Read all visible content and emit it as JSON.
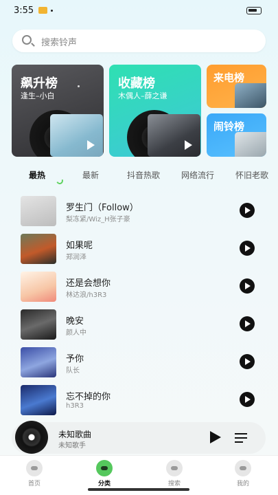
{
  "status_bar": {
    "time": "3:55"
  },
  "search": {
    "placeholder": "搜索铃声"
  },
  "categories": [
    {
      "title": "飙升榜",
      "subtitle": "逢生–小白"
    },
    {
      "title": "收藏榜",
      "subtitle": "木偶人–薛之谦"
    },
    {
      "title": "来电榜"
    },
    {
      "title": "闹铃榜"
    }
  ],
  "tabs": [
    "最热",
    "最新",
    "抖音热歌",
    "网络流行",
    "怀旧老歌"
  ],
  "active_tab": "最热",
  "songs": [
    {
      "title": "罗生门（Follow）",
      "artist": "梨冻紧/Wiz_H张子豪"
    },
    {
      "title": "如果呢",
      "artist": "郑润泽"
    },
    {
      "title": "还是会想你",
      "artist": "林达浪/h3R3"
    },
    {
      "title": "晚安",
      "artist": "颜人中"
    },
    {
      "title": "予你",
      "artist": "队长"
    },
    {
      "title": "忘不掉的你",
      "artist": "h3R3"
    }
  ],
  "player": {
    "title": "未知歌曲",
    "artist": "未知歌手"
  },
  "nav": [
    {
      "label": "首页",
      "icon": "home-icon"
    },
    {
      "label": "分类",
      "icon": "category-icon",
      "active": true
    },
    {
      "label": "搜索",
      "icon": "search-icon"
    },
    {
      "label": "我的",
      "icon": "profile-icon"
    }
  ],
  "colors": {
    "accent_green": "#55c85d",
    "rise": "#3a3a3d",
    "fav": "#2fe0b2",
    "call": "#ff9d2f",
    "alarm": "#3aa8f7"
  }
}
